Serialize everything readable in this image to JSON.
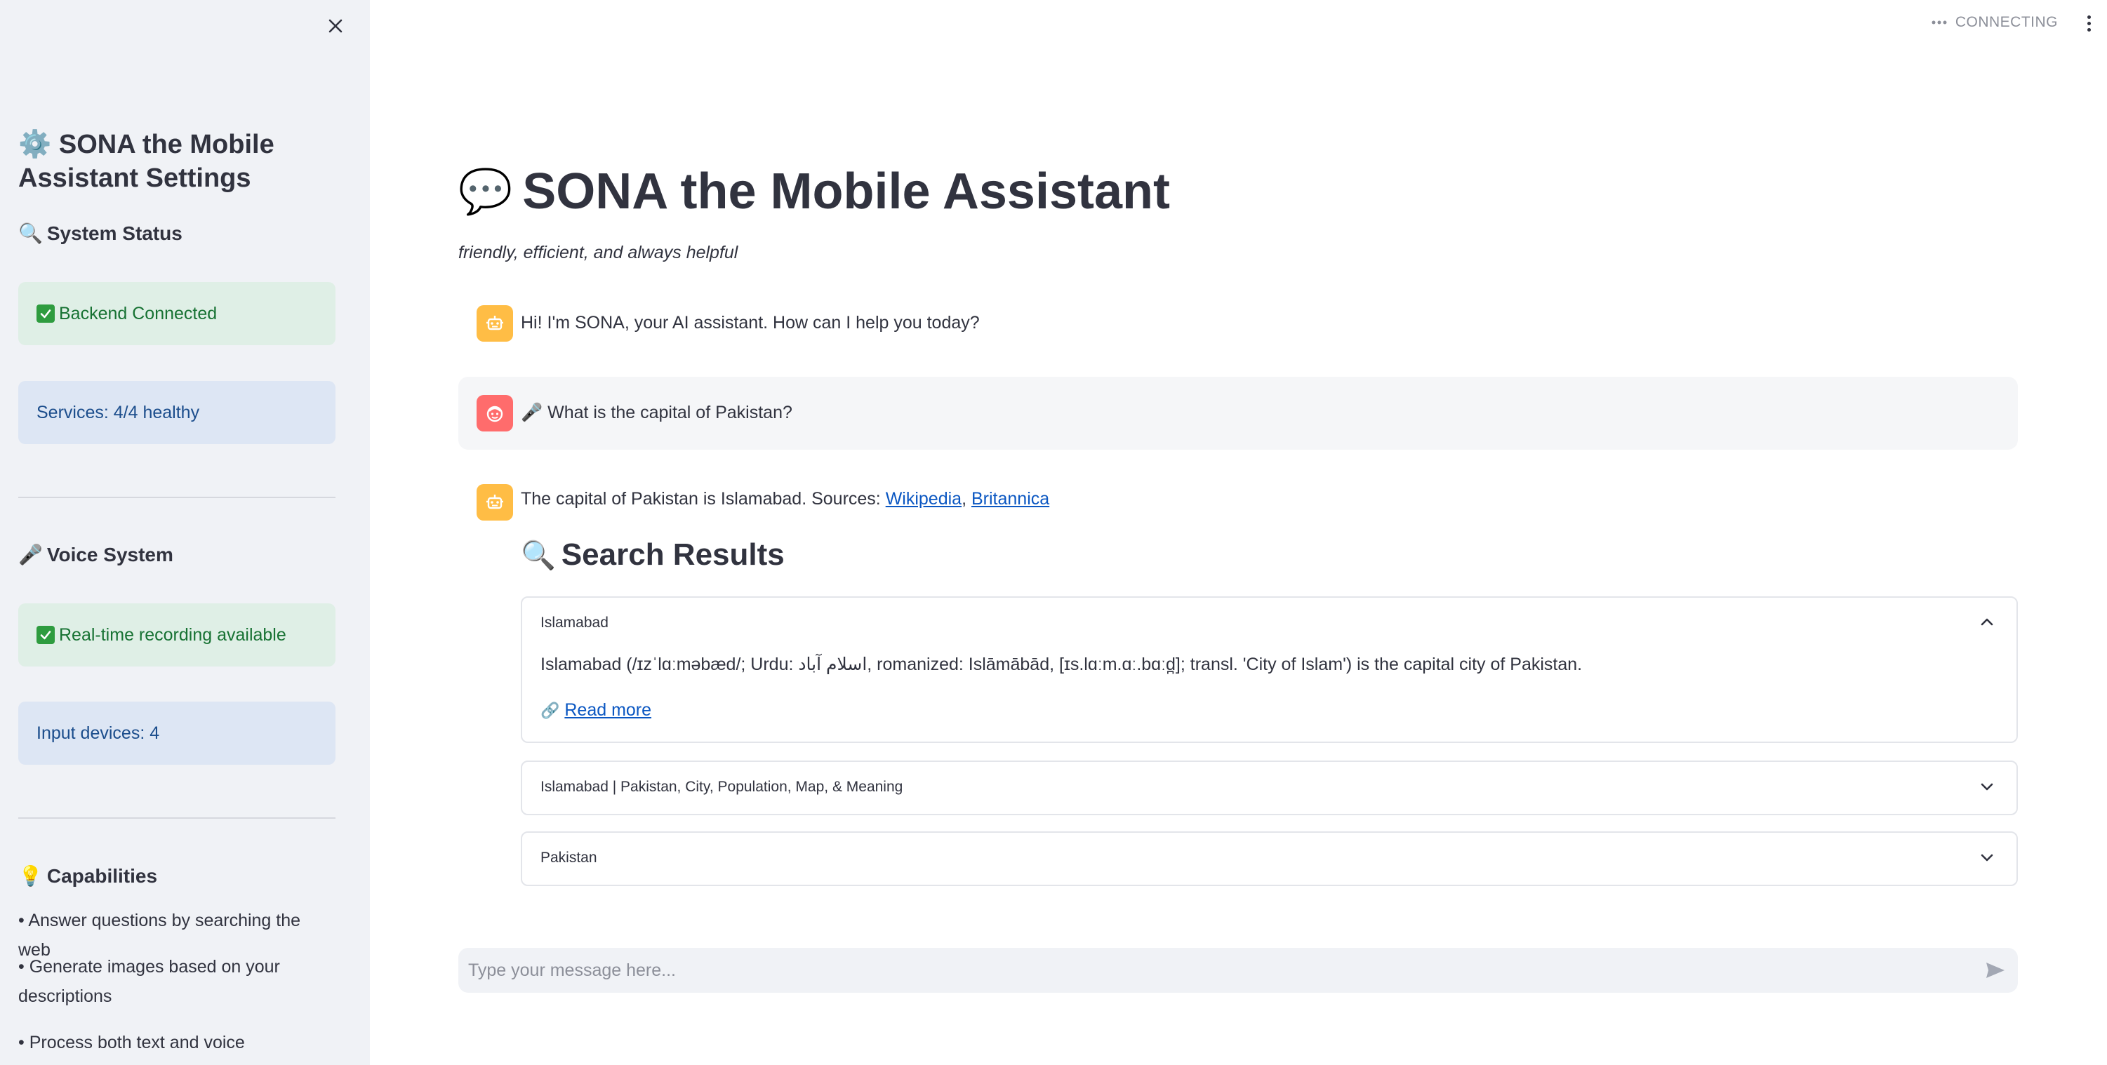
{
  "sidebar": {
    "title_emoji": "⚙️",
    "title": "SONA the Mobile Assistant Settings",
    "system_status": {
      "heading_emoji": "🔍",
      "heading": "System Status",
      "backend": "Backend Connected",
      "services": "Services: 4/4 healthy"
    },
    "voice_system": {
      "heading_emoji": "🎤",
      "heading": "Voice System",
      "recording": "Real-time recording available",
      "devices": "Input devices: 4"
    },
    "capabilities": {
      "heading_emoji": "💡",
      "heading": "Capabilities",
      "items": [
        "• Answer questions by searching the web",
        "• Generate images based on your descriptions",
        "• Process both text and voice commands"
      ]
    }
  },
  "header": {
    "status": "CONNECTING"
  },
  "main": {
    "title_emoji": "💬",
    "title": "SONA the Mobile Assistant",
    "subtitle": "friendly, efficient, and always helpful",
    "messages": [
      {
        "role": "assistant",
        "text": "Hi! I'm SONA, your AI assistant. How can I help you today?"
      },
      {
        "role": "user",
        "prefix": "🎤",
        "text": "What is the capital of Pakistan?"
      },
      {
        "role": "assistant",
        "text": "The capital of Pakistan is Islamabad. Sources: ",
        "links": [
          "Wikipedia",
          "Britannica"
        ],
        "separator": ", "
      }
    ],
    "search_results": {
      "heading_emoji": "🔍",
      "heading": "Search Results",
      "items": [
        {
          "title": "Islamabad",
          "expanded": true,
          "body": "Islamabad (/ɪzˈlɑːməbæd/; Urdu: اسلام آباد, romanized: Islāmābād, [ɪs.lɑːm.ɑː.bɑːd̪]; transl. 'City of Islam') is the capital city of Pakistan.",
          "link_emoji": "🔗",
          "link": "Read more"
        },
        {
          "title": "Islamabad | Pakistan, City, Population, Map, & Meaning",
          "expanded": false
        },
        {
          "title": "Pakistan",
          "expanded": false
        }
      ]
    },
    "chat_input": {
      "placeholder": "Type your message here..."
    }
  }
}
